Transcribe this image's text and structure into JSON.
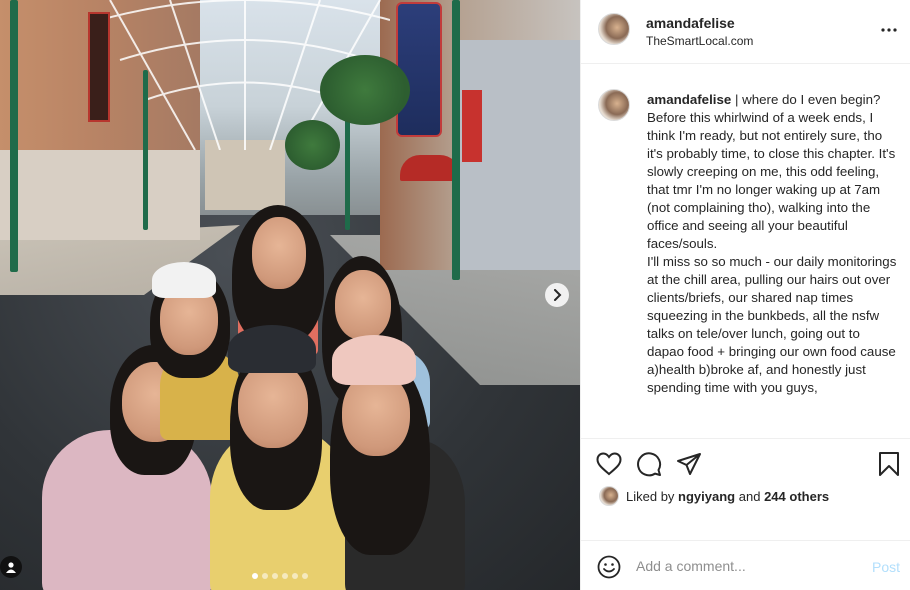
{
  "post": {
    "username": "amandafelise",
    "location": "TheSmartLocal.com",
    "more_icon": "more-horizontal-icon"
  },
  "caption": {
    "username": "amandafelise",
    "paragraph1": "| where do I even begin? Before this whirlwind of a week ends, I think I'm ready, but not entirely sure, tho it's probably time, to close this chapter. It's slowly creeping on me, this odd feeling, that tmr I'm no longer waking up at 7am (not complaining tho), walking into the office and seeing all your beautiful faces/souls.",
    "paragraph2": "I'll miss so so much - our daily monitorings at the chill area, pulling our hairs out over clients/briefs, our shared nap times squeezing in the bunkbeds, all the nsfw talks on tele/over lunch, going out to dapao food + bringing our own food cause a)health b)broke af, and honestly just spending time with you guys,"
  },
  "likes": {
    "prefix": "Liked by",
    "user": "ngyiyang",
    "joiner": "and",
    "others": "244 others"
  },
  "comment": {
    "placeholder": "Add a comment...",
    "post_label": "Post"
  },
  "carousel": {
    "slide_count": 6,
    "active_index": 0
  },
  "icons": {
    "like": "heart-icon",
    "comment": "comment-icon",
    "share": "send-icon",
    "save": "bookmark-icon",
    "emoji": "emoji-icon",
    "next": "chevron-right-icon",
    "tag": "user-tag-icon"
  },
  "colors": {
    "post_button": "#b2dffc",
    "text": "#262626",
    "secondary_text": "#8e8e8e",
    "divider": "#efefef"
  }
}
